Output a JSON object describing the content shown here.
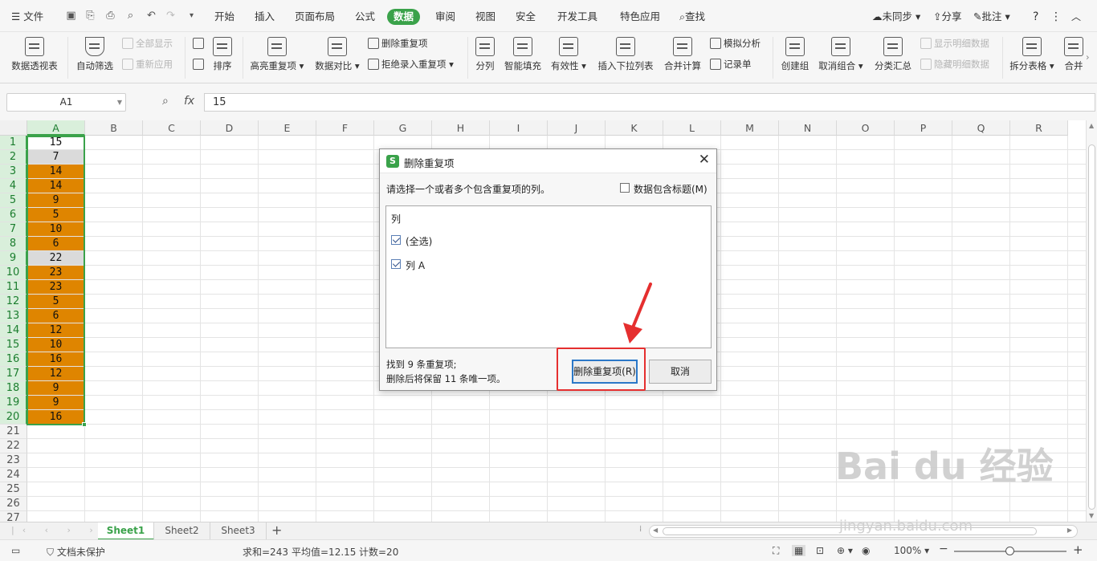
{
  "menubar": {
    "file_label": "文件",
    "tabs": [
      "开始",
      "插入",
      "页面布局",
      "公式",
      "数据",
      "审阅",
      "视图",
      "安全",
      "开发工具",
      "特色应用"
    ],
    "active_tab": "数据",
    "search_label": "查找",
    "sync_label": "未同步",
    "share_label": "分享",
    "annotate_label": "批注",
    "help_label": "?"
  },
  "ribbon": {
    "pivot": "数据透视表",
    "autofilter": "自动筛选",
    "show_all": "全部显示",
    "reapply": "重新应用",
    "sort": "排序",
    "highlight_dup": "高亮重复项",
    "compare": "数据对比",
    "remove_dup": "删除重复项",
    "reject_dup": "拒绝录入重复项",
    "split": "分列",
    "smart_fill": "智能填充",
    "validity": "有效性",
    "insert_dropdown": "插入下拉列表",
    "consolidate": "合并计算",
    "simulate": "模拟分析",
    "record": "记录单",
    "create_group": "创建组",
    "ungroup": "取消组合",
    "subtotal": "分类汇总",
    "show_detail": "显示明细数据",
    "hide_detail": "隐藏明细数据",
    "split_table": "拆分表格",
    "merge": "合并"
  },
  "formula_bar": {
    "name_box": "A1",
    "fx_label": "fx",
    "formula": "15"
  },
  "sheet": {
    "columns": [
      "A",
      "B",
      "C",
      "D",
      "E",
      "F",
      "G",
      "H",
      "I",
      "J",
      "K",
      "L",
      "M",
      "N",
      "O",
      "P",
      "Q",
      "R"
    ],
    "rows": [
      "1",
      "2",
      "3",
      "4",
      "5",
      "6",
      "7",
      "8",
      "9",
      "10",
      "11",
      "12",
      "13",
      "14",
      "15",
      "16",
      "17",
      "18",
      "19",
      "20",
      "21",
      "22",
      "23",
      "24",
      "25",
      "26",
      "27"
    ],
    "cells_A": [
      "15",
      "7",
      "14",
      "14",
      "9",
      "5",
      "10",
      "6",
      "22",
      "23",
      "23",
      "5",
      "6",
      "12",
      "10",
      "16",
      "12",
      "9",
      "9",
      "16"
    ],
    "cell_state": [
      "none",
      "gray",
      "dup",
      "dup",
      "dup",
      "dup",
      "dup",
      "dup",
      "gray",
      "dup",
      "dup",
      "dup",
      "dup",
      "dup",
      "dup",
      "dup",
      "dup",
      "dup",
      "dup",
      "dup"
    ],
    "highlight_color": "#df8500"
  },
  "sheet_tabs": [
    "Sheet1",
    "Sheet2",
    "Sheet3"
  ],
  "active_sheet": "Sheet1",
  "status": {
    "protect": "文档未保护",
    "sum": "求和=243",
    "avg": "平均值=12.15",
    "count": "计数=20",
    "zoom": "100%"
  },
  "dialog": {
    "title": "删除重复项",
    "prompt": "请选择一个或者多个包含重复项的列。",
    "header_checkbox": "数据包含标题(M)",
    "list_header": "列",
    "items": [
      "(全选)",
      "列 A"
    ],
    "info1": "找到 9 条重复项;",
    "info2": "删除后将保留 11 条唯一项。",
    "ok": "删除重复项(R)",
    "cancel": "取消"
  },
  "watermark": {
    "brand": "Bai du 经验",
    "url": "jingyan.baidu.com"
  }
}
